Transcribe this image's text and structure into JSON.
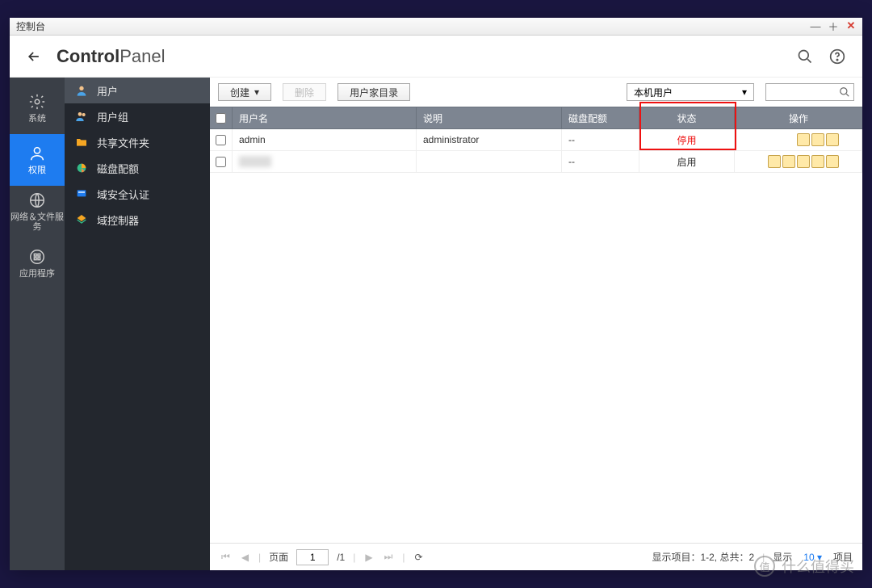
{
  "window": {
    "title": "控制台"
  },
  "header": {
    "title_bold": "Control",
    "title_light": "Panel"
  },
  "navrail": [
    {
      "key": "system",
      "label": "系统",
      "active": false
    },
    {
      "key": "perm",
      "label": "权限",
      "active": true
    },
    {
      "key": "network",
      "label": "网络＆文件服务",
      "active": false
    },
    {
      "key": "apps",
      "label": "应用程序",
      "active": false
    }
  ],
  "sidebar": [
    {
      "key": "user",
      "label": "用户",
      "active": true
    },
    {
      "key": "group",
      "label": "用户组",
      "active": false
    },
    {
      "key": "share",
      "label": "共享文件夹",
      "active": false
    },
    {
      "key": "quota",
      "label": "磁盘配额",
      "active": false
    },
    {
      "key": "domain",
      "label": "域安全认证",
      "active": false
    },
    {
      "key": "dc",
      "label": "域控制器",
      "active": false
    }
  ],
  "toolbar": {
    "create": "创建",
    "delete": "删除",
    "home_dir": "用户家目录",
    "filter_selected": "本机用户"
  },
  "table": {
    "cols": {
      "username": "用户名",
      "desc": "说明",
      "quota": "磁盘配额",
      "status": "状态",
      "ops": "操作"
    },
    "rows": [
      {
        "username": "admin",
        "desc": "administrator",
        "quota": "--",
        "status": "停用",
        "status_style": "disabled",
        "op_count": 3
      },
      {
        "username": "",
        "desc": "",
        "quota": "--",
        "status": "启用",
        "status_style": "enabled",
        "op_count": 5,
        "blurred_name": true
      }
    ]
  },
  "pager": {
    "page_label": "页面",
    "page": "1",
    "total_pages": "/1",
    "summary": "显示项目：1-2, 总共：2",
    "show_label": "显示",
    "page_size": "10",
    "items_label": "项目"
  },
  "watermark": {
    "badge": "值",
    "text": "什么值得买"
  }
}
